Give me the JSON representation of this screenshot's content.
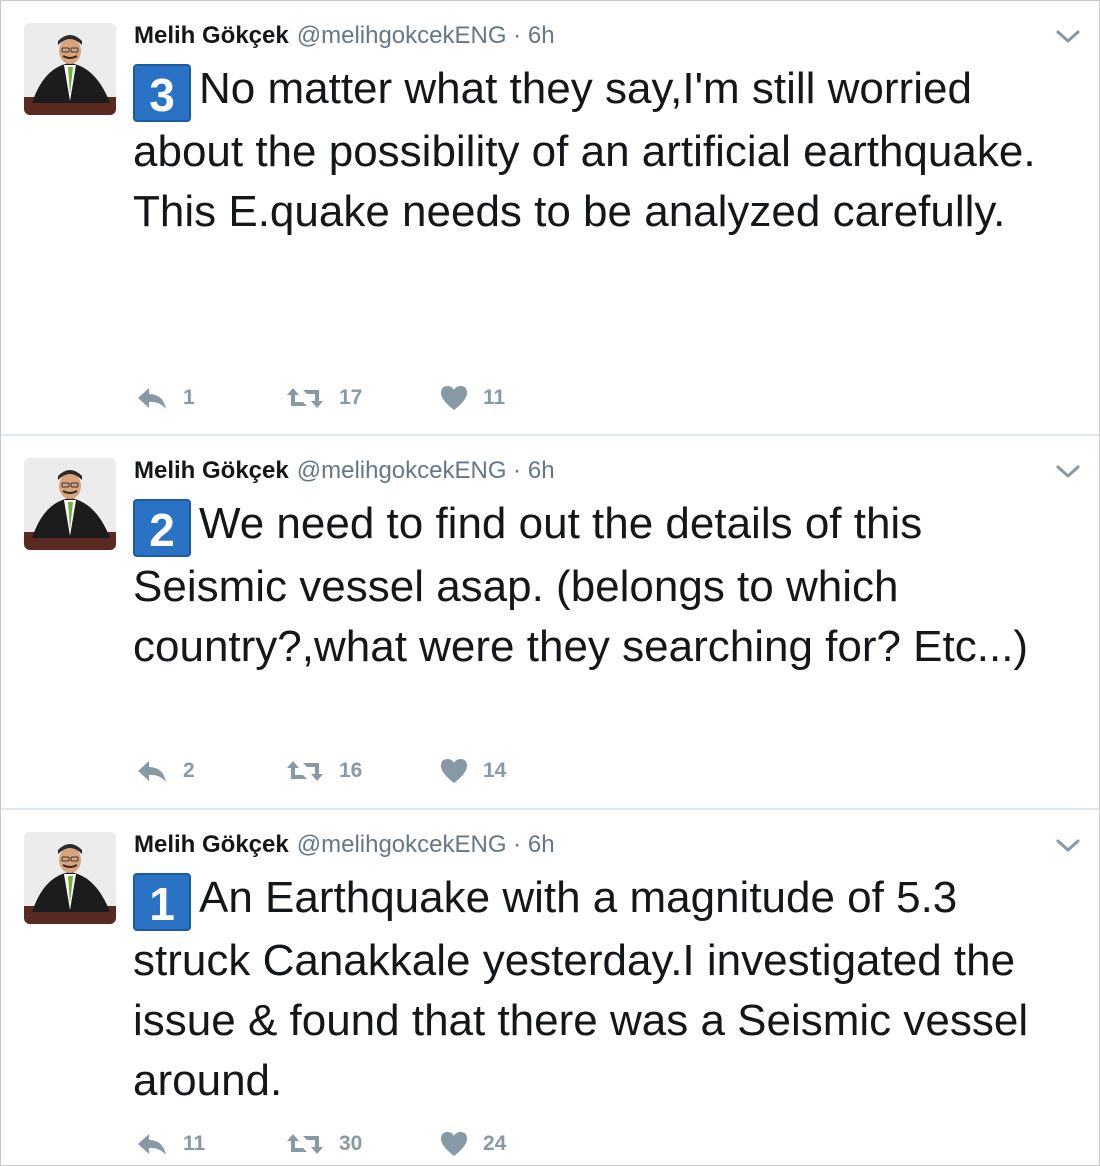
{
  "colors": {
    "text": "#14171a",
    "muted": "#657786",
    "action_gray": "#8899a6",
    "badge_blue": "#2a73c4",
    "divider": "#e1e8ed"
  },
  "tweets": [
    {
      "author_name": "Melih Gökçek",
      "author_handle": "@melihgokcekENG",
      "separator": "·",
      "time": "6h",
      "badge": "3",
      "lines": [
        "No matter what they say,I'm still worried about the possibility of an artificial earthquake.",
        "This E.quake needs to be analyzed carefully."
      ],
      "replies": "1",
      "retweets": "17",
      "likes": "11",
      "icons": [
        "reply-icon",
        "retweet-icon",
        "heart-icon",
        "chevron-down-icon"
      ]
    },
    {
      "author_name": "Melih Gökçek",
      "author_handle": "@melihgokcekENG",
      "separator": "·",
      "time": "6h",
      "badge": "2",
      "lines": [
        "We need to find out the details of this Seismic vessel asap. (belongs to which country?,what were they searching for? Etc...)"
      ],
      "replies": "2",
      "retweets": "16",
      "likes": "14",
      "icons": [
        "reply-icon",
        "retweet-icon",
        "heart-icon",
        "chevron-down-icon"
      ]
    },
    {
      "author_name": "Melih Gökçek",
      "author_handle": "@melihgokcekENG",
      "separator": "·",
      "time": "6h",
      "badge": "1",
      "lines": [
        "An Earthquake with a magnitude of 5.3 struck Canakkale yesterday.I investigated the issue & found that there was a Seismic vessel around."
      ],
      "replies": "11",
      "retweets": "30",
      "likes": "24",
      "icons": [
        "reply-icon",
        "retweet-icon",
        "heart-icon",
        "chevron-down-icon"
      ]
    }
  ]
}
